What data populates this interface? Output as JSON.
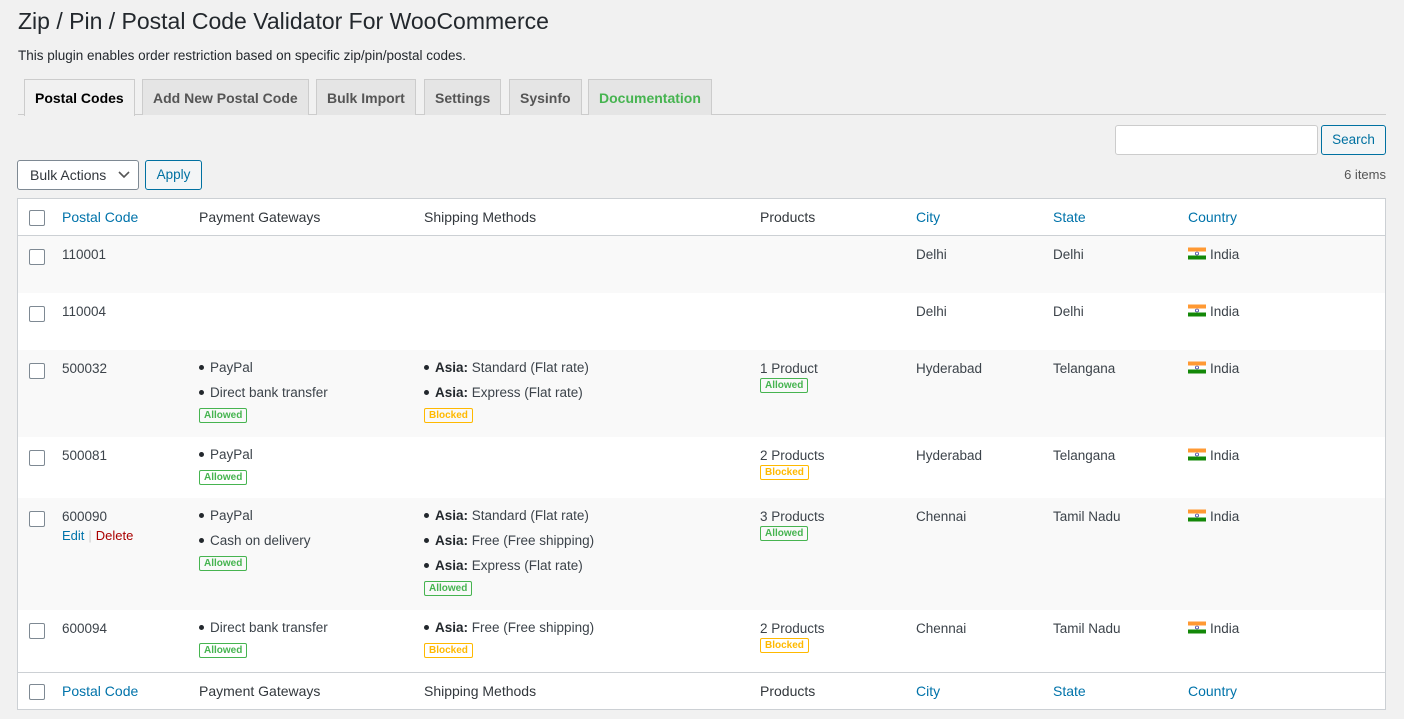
{
  "page": {
    "title": "Zip / Pin / Postal Code Validator For WooCommerce",
    "description": "This plugin enables order restriction based on specific zip/pin/postal codes."
  },
  "tabs": [
    {
      "label": "Postal Codes",
      "active": true
    },
    {
      "label": "Add New Postal Code"
    },
    {
      "label": "Bulk Import"
    },
    {
      "label": "Settings"
    },
    {
      "label": "Sysinfo"
    },
    {
      "label": "Documentation",
      "color": "#46b450"
    }
  ],
  "search": {
    "value": "",
    "placeholder": "",
    "button_label": "Search"
  },
  "bulk": {
    "selected": "Bulk Actions",
    "apply_label": "Apply"
  },
  "items_count": "6 items",
  "columns": {
    "postal_code": "Postal Code",
    "payment_gateways": "Payment Gateways",
    "shipping_methods": "Shipping Methods",
    "products": "Products",
    "city": "City",
    "state": "State",
    "country": "Country"
  },
  "row_actions": {
    "edit": "Edit",
    "separator": "|",
    "delete": "Delete"
  },
  "rows": [
    {
      "code": "110001",
      "payments": [],
      "payment_status": "",
      "shipping": [],
      "shipping_status": "",
      "products": "",
      "product_status": "",
      "city": "Delhi",
      "state": "Delhi",
      "country": "India"
    },
    {
      "code": "110004",
      "payments": [],
      "payment_status": "",
      "shipping": [],
      "shipping_status": "",
      "products": "",
      "product_status": "",
      "city": "Delhi",
      "state": "Delhi",
      "country": "India"
    },
    {
      "code": "500032",
      "payments": [
        "PayPal",
        "Direct bank transfer"
      ],
      "payment_status": "Allowed",
      "shipping": [
        {
          "zone": "Asia:",
          "method": "Standard (Flat rate)"
        },
        {
          "zone": "Asia:",
          "method": "Express (Flat rate)"
        }
      ],
      "shipping_status": "Blocked",
      "products": "1 Product",
      "product_status": "Allowed",
      "city": "Hyderabad",
      "state": "Telangana",
      "country": "India"
    },
    {
      "code": "500081",
      "payments": [
        "PayPal"
      ],
      "payment_status": "Allowed",
      "shipping": [],
      "shipping_status": "",
      "products": "2 Products",
      "product_status": "Blocked",
      "city": "Hyderabad",
      "state": "Telangana",
      "country": "India"
    },
    {
      "code": "600090",
      "payments": [
        "PayPal",
        "Cash on delivery"
      ],
      "payment_status": "Allowed",
      "shipping": [
        {
          "zone": "Asia:",
          "method": "Standard (Flat rate)"
        },
        {
          "zone": "Asia:",
          "method": "Free (Free shipping)"
        },
        {
          "zone": "Asia:",
          "method": "Express (Flat rate)"
        }
      ],
      "shipping_status": "Allowed",
      "products": "3 Products",
      "product_status": "Allowed",
      "city": "Chennai",
      "state": "Tamil Nadu",
      "country": "India",
      "show_actions": true
    },
    {
      "code": "600094",
      "payments": [
        "Direct bank transfer"
      ],
      "payment_status": "Allowed",
      "shipping": [
        {
          "zone": "Asia:",
          "method": "Free (Free shipping)"
        }
      ],
      "shipping_status": "Blocked",
      "products": "2 Products",
      "product_status": "Blocked",
      "city": "Chennai",
      "state": "Tamil Nadu",
      "country": "India"
    }
  ],
  "colors": {
    "allowed": "#46b450",
    "blocked": "#ffb900",
    "link": "#0073aa",
    "delete": "#aa0000"
  },
  "icons": {
    "country_flag": "india-flag-icon",
    "dropdown": "chevron-down-icon"
  }
}
